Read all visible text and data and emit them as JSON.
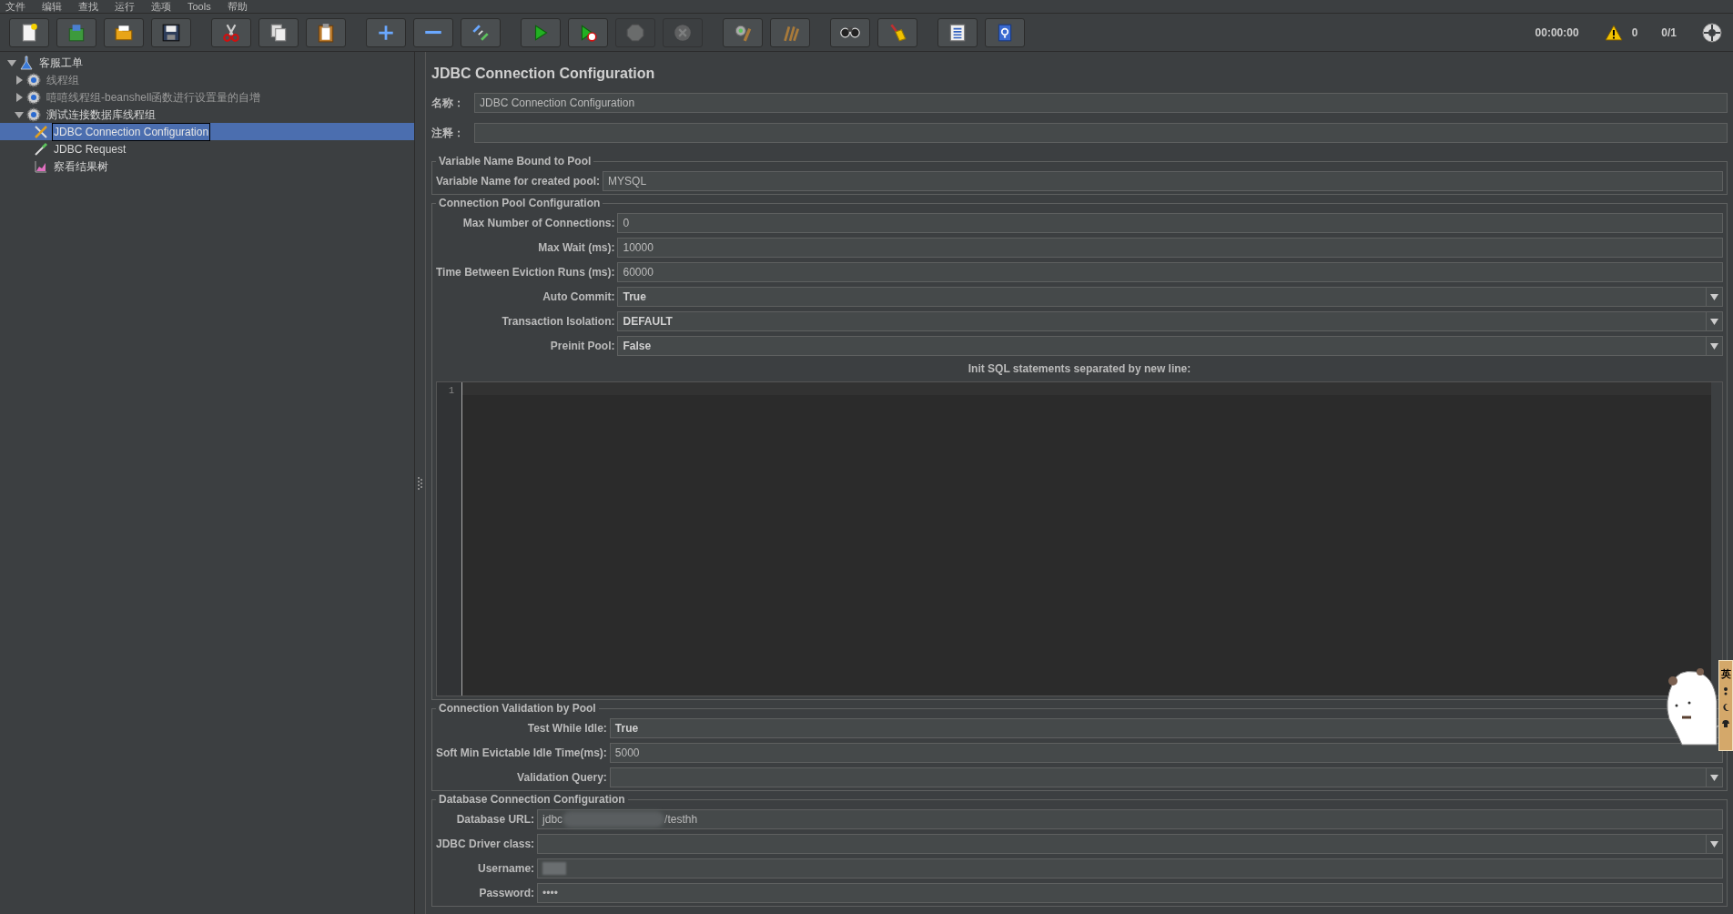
{
  "menu_bar": [
    "文件",
    "编辑",
    "查找",
    "运行",
    "选项",
    "Tools",
    "帮助"
  ],
  "toolbar": {
    "groups": [
      [
        {
          "kind": "new",
          "disabled": false
        },
        {
          "kind": "templates",
          "disabled": false
        },
        {
          "kind": "open",
          "disabled": false
        },
        {
          "kind": "save",
          "disabled": false
        }
      ],
      [
        {
          "kind": "cut",
          "disabled": false
        },
        {
          "kind": "copy",
          "disabled": false
        },
        {
          "kind": "paste",
          "disabled": false
        }
      ],
      [
        {
          "kind": "expand",
          "disabled": false
        },
        {
          "kind": "collapse",
          "disabled": false
        },
        {
          "kind": "toggle",
          "disabled": false
        }
      ],
      [
        {
          "kind": "start",
          "disabled": false
        },
        {
          "kind": "start_no_pauses",
          "disabled": false
        },
        {
          "kind": "stop",
          "disabled": true
        },
        {
          "kind": "shutdown",
          "disabled": true
        }
      ],
      [
        {
          "kind": "clear",
          "disabled": false
        },
        {
          "kind": "clear_all",
          "disabled": false
        }
      ],
      [
        {
          "kind": "search",
          "disabled": false
        },
        {
          "kind": "reset_search",
          "disabled": false
        }
      ],
      [
        {
          "kind": "function_helper",
          "disabled": false
        },
        {
          "kind": "help",
          "disabled": false
        }
      ]
    ],
    "timer": "00:00:00",
    "warnings": "0",
    "threads": "0/1"
  },
  "tree": [
    {
      "label": "客服工单",
      "kind": "test_plan",
      "expanded": true,
      "selected": false,
      "enabled": true,
      "children": [
        {
          "label": "线程组",
          "kind": "thread_group",
          "expanded": false,
          "selected": false,
          "enabled": false
        },
        {
          "label": "嘻嘻线程组-beanshell函数进行设置量的自增",
          "kind": "thread_group",
          "expanded": false,
          "selected": false,
          "enabled": false
        },
        {
          "label": "测试连接数据库线程组",
          "kind": "thread_group",
          "expanded": true,
          "selected": false,
          "enabled": true,
          "children": [
            {
              "label": "JDBC Connection Configuration",
              "kind": "config",
              "selected": true,
              "enabled": true
            },
            {
              "label": "JDBC Request",
              "kind": "sampler",
              "selected": false,
              "enabled": true
            },
            {
              "label": "察看结果树",
              "kind": "listener",
              "selected": false,
              "enabled": true
            }
          ]
        }
      ]
    }
  ],
  "editor": {
    "title": "JDBC Connection Configuration",
    "name_label": "名称：",
    "name_value": "JDBC Connection Configuration",
    "comment_label": "注释：",
    "sections": [
      {
        "legend": "Variable Name Bound to Pool",
        "fields": [
          {
            "kind": "text",
            "label": "Variable Name for created pool:",
            "value": "MYSQL"
          }
        ]
      },
      {
        "legend": "Connection Pool Configuration",
        "fields": [
          {
            "kind": "text",
            "label": "Max Number of Connections:",
            "value": "0"
          },
          {
            "kind": "text",
            "label": "Max Wait (ms):",
            "value": "10000"
          },
          {
            "kind": "text",
            "label": "Time Between Eviction Runs (ms):",
            "value": "60000"
          },
          {
            "kind": "combo",
            "label": "Auto Commit:",
            "value": "True"
          },
          {
            "kind": "combo",
            "label": "Transaction Isolation:",
            "value": "DEFAULT"
          },
          {
            "kind": "combo",
            "label": "Preinit Pool:",
            "value": "False"
          },
          {
            "kind": "code",
            "label": "Init SQL statements separated by new line:",
            "line_numbers": [
              "1"
            ]
          }
        ]
      },
      {
        "legend": "Connection Validation by Pool",
        "fields": [
          {
            "kind": "combo",
            "label": "Test While Idle:",
            "value": "True"
          },
          {
            "kind": "text",
            "label": "Soft Min Evictable Idle Time(ms):",
            "value": "5000"
          },
          {
            "kind": "combo",
            "label": "Validation Query:"
          }
        ]
      },
      {
        "legend": "Database Connection Configuration",
        "fields": [
          {
            "kind": "text",
            "label": "Database URL:",
            "value": "jdbc",
            "value_end": "/testhh",
            "redacted": true
          },
          {
            "kind": "combo",
            "label": "JDBC Driver class:"
          },
          {
            "kind": "text",
            "label": "Username:",
            "redacted": true
          },
          {
            "kind": "text",
            "label": "Password:",
            "value": "••••"
          }
        ]
      }
    ]
  },
  "ime_widget": {
    "label": "英"
  }
}
